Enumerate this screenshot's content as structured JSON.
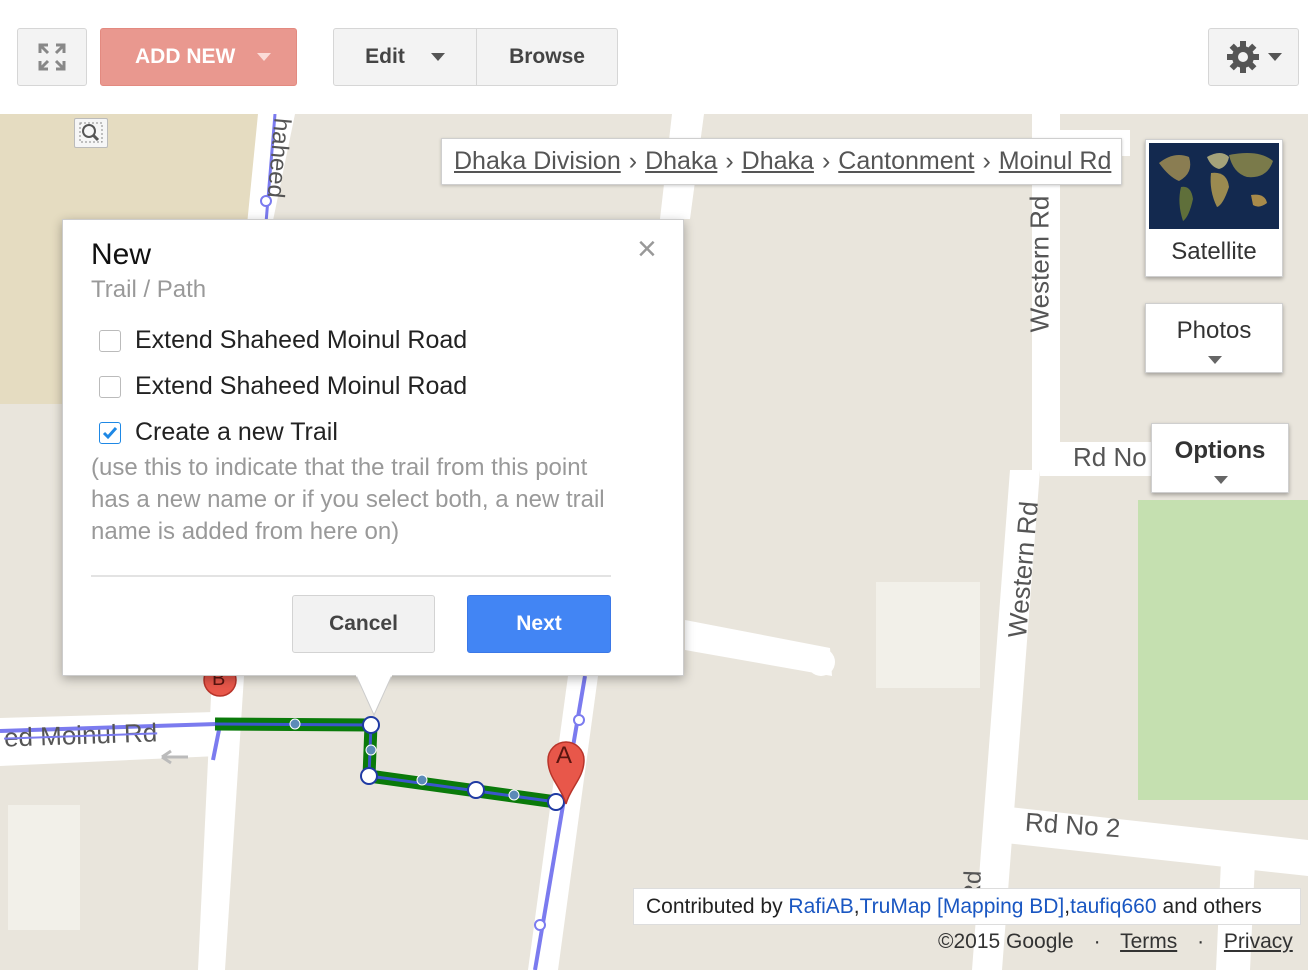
{
  "toolbar": {
    "add_new_label": "ADD NEW",
    "edit_label": "Edit",
    "browse_label": "Browse",
    "fullscreen_icon": "fullscreen-icon",
    "settings_icon": "gear-icon"
  },
  "breadcrumb": {
    "items": [
      "Dhaka Division",
      "Dhaka",
      "Dhaka",
      "Cantonment",
      "Moinul Rd"
    ],
    "separator": "›"
  },
  "map": {
    "road_labels": [
      "Western Rd",
      "Western Rd",
      "Rd No",
      "Rd No 2",
      "ed Moinul Rd",
      "haheed",
      "Rd"
    ],
    "satellite_label": "Satellite",
    "photos_label": "Photos",
    "options_label": "Options",
    "marker_a": "A",
    "marker_b": "B",
    "colors": {
      "route": "#0a7a0a",
      "road_line": "#7b7bef",
      "marker": "#e8574a",
      "park": "#c5e0b0"
    }
  },
  "dialog": {
    "title": "New",
    "subtitle": "Trail / Path",
    "options": [
      {
        "label": "Extend Shaheed Moinul Road",
        "checked": false
      },
      {
        "label": "Extend Shaheed Moinul Road",
        "checked": false
      },
      {
        "label": "Create a new Trail",
        "checked": true
      }
    ],
    "hint": "(use this to indicate that the trail from this point has a new name or if you select both, a new trail name is added from here on)",
    "cancel_label": "Cancel",
    "next_label": "Next",
    "close_symbol": "×"
  },
  "attribution": {
    "prefix": "Contributed by ",
    "contributors": [
      "RafiAB",
      "TruMap [Mapping BD]",
      "taufiq660"
    ],
    "suffix": "and others"
  },
  "footer": {
    "copyright": "©2015 Google",
    "dot": "·",
    "terms": "Terms",
    "privacy": "Privacy"
  }
}
